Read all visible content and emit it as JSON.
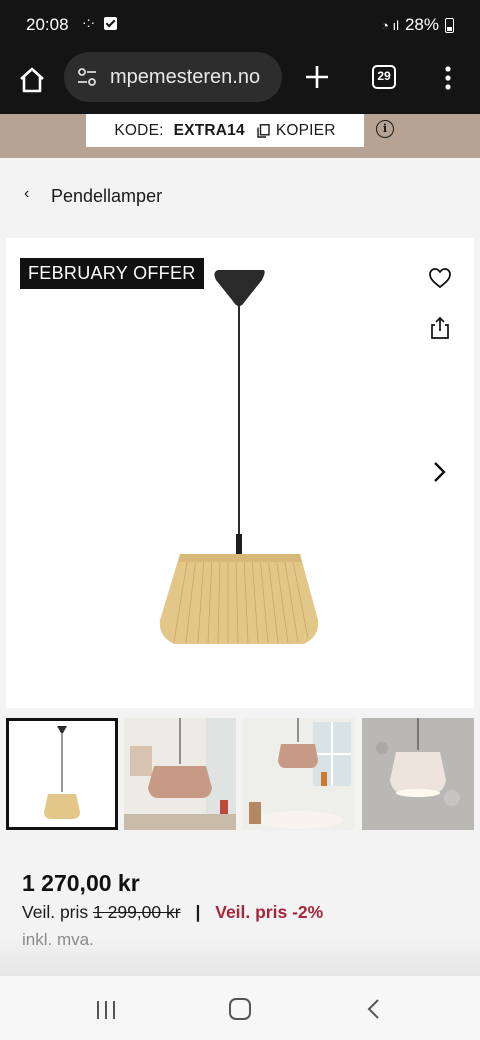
{
  "status_bar": {
    "time": "20:08",
    "battery": "28%"
  },
  "browser": {
    "url": "mpemesteren.no",
    "tab_count": "29"
  },
  "promo": {
    "code_label": "KODE:",
    "code": "EXTRA14",
    "copy_label": "KOPIER"
  },
  "breadcrumb": {
    "label": "Pendellamper"
  },
  "product": {
    "badge": "FEBRUARY OFFER",
    "price": "1 270,00 kr",
    "rrp_label": "Veil. pris",
    "rrp_value": "1 299,00 kr",
    "separator": "|",
    "discount": "Veil. pris -2%",
    "vat": "inkl. mva."
  },
  "colors": {
    "discount": "#a4283c",
    "promo_band": "#b6a393",
    "shade": "#e3c788"
  },
  "icons": [
    "home-icon",
    "tune-icon",
    "plus-icon",
    "tabs-icon",
    "more-vert-icon",
    "copy-icon",
    "info-icon",
    "chevron-left-icon",
    "heart-icon",
    "share-icon",
    "chevron-right-icon"
  ]
}
